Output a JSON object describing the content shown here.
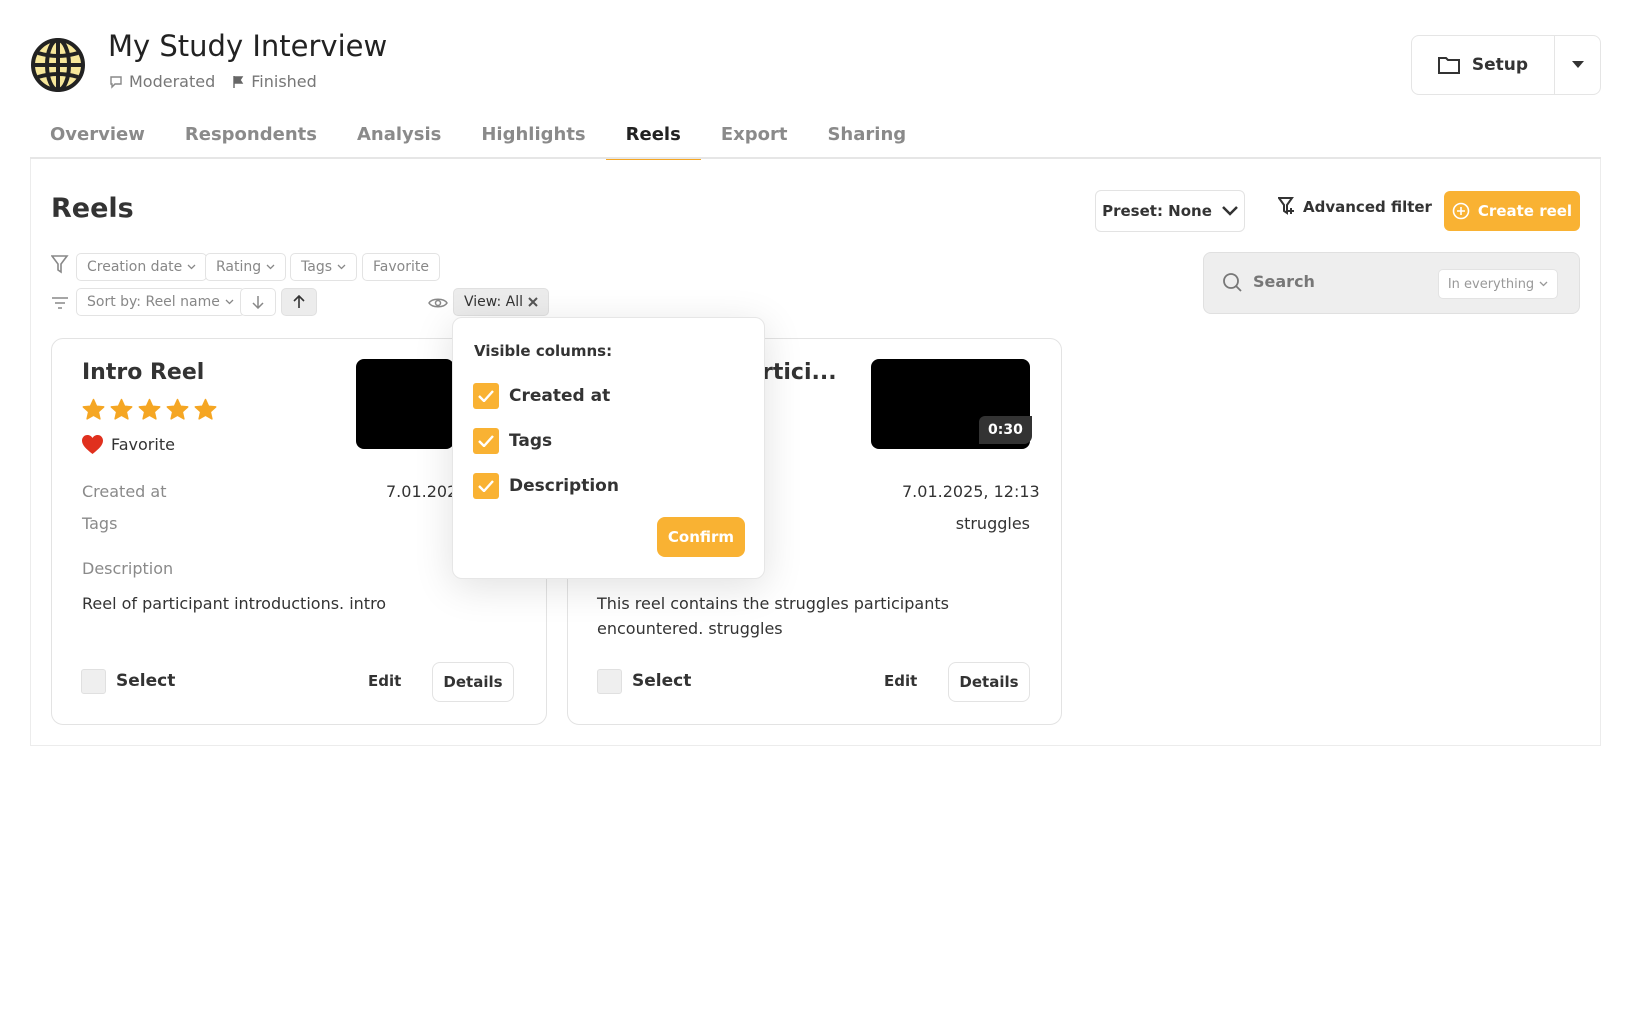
{
  "study": {
    "title": "My Study Interview",
    "type": "Moderated",
    "status": "Finished",
    "icon": "globe-icon"
  },
  "header": {
    "setup_label": "Setup"
  },
  "tabs": [
    {
      "label": "Overview",
      "active": false
    },
    {
      "label": "Respondents",
      "active": false
    },
    {
      "label": "Analysis",
      "active": false
    },
    {
      "label": "Highlights",
      "active": false
    },
    {
      "label": "Reels",
      "active": true
    },
    {
      "label": "Export",
      "active": false
    },
    {
      "label": "Sharing",
      "active": false
    }
  ],
  "reels": {
    "title": "Reels",
    "preset_label": "Preset: None",
    "advanced_filter_label": "Advanced filter",
    "create_label": "Create reel",
    "search": {
      "label": "Search",
      "scope": "In everything"
    },
    "filters": {
      "creation_date": "Creation date",
      "rating": "Rating",
      "tags": "Tags",
      "favorite": "Favorite"
    },
    "sort": {
      "label": "Sort by: Reel name"
    },
    "view": {
      "label": "View: All"
    }
  },
  "cards": [
    {
      "title": "Intro Reel",
      "rating": 5,
      "favorite_label": "Favorite",
      "created_at_label": "Created at",
      "created_at_value": "7.01.202",
      "tags_label": "Tags",
      "tags_value": "",
      "description_label": "Description",
      "description": "Reel of participant introductions. intro",
      "select_label": "Select",
      "edit_label": "Edit",
      "details_label": "Details"
    },
    {
      "title": "rtici...",
      "duration": "0:30",
      "created_at_value": "7.01.2025, 12:13",
      "tags_value": "struggles",
      "description": "This reel contains the struggles participants encountered. struggles",
      "select_label": "Select",
      "edit_label": "Edit",
      "details_label": "Details"
    }
  ],
  "popover": {
    "title": "Visible columns:",
    "options": [
      {
        "label": "Created at",
        "checked": true
      },
      {
        "label": "Tags",
        "checked": true
      },
      {
        "label": "Description",
        "checked": true
      }
    ],
    "confirm_label": "Confirm"
  },
  "colors": {
    "accent": "#f9b233",
    "tab_underline": "#f5a623",
    "favorite": "#e0301e",
    "star": "#f5a623"
  }
}
